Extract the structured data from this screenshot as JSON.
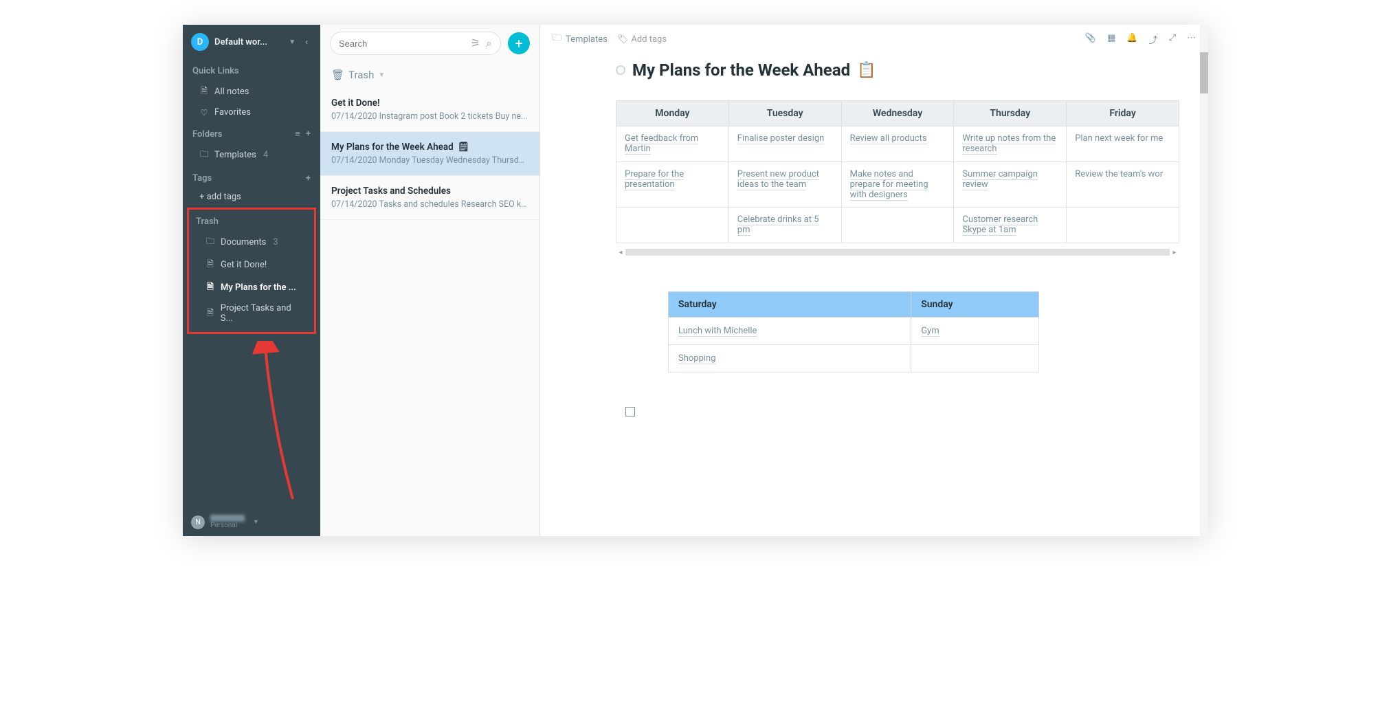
{
  "workspace": {
    "avatar": "D",
    "name": "Default wor..."
  },
  "sidebar": {
    "quick_links_label": "Quick Links",
    "all_notes": "All notes",
    "favorites": "Favorites",
    "folders_label": "Folders",
    "templates": {
      "label": "Templates",
      "count": "4"
    },
    "tags_label": "Tags",
    "add_tags": "+ add tags",
    "trash_label": "Trash",
    "trash_items": {
      "documents": {
        "label": "Documents",
        "count": "3"
      },
      "get_it_done": "Get it Done!",
      "my_plans": "My Plans for the ...",
      "project_tasks": "Project Tasks and S..."
    }
  },
  "user": {
    "avatar": "N",
    "plan": "Personal"
  },
  "search": {
    "placeholder": "Search"
  },
  "list": {
    "title": "Trash",
    "items": [
      {
        "title": "Get it Done!",
        "preview": "07/14/2020 Instagram post Book 2 tickets Buy ne..."
      },
      {
        "title": "My Plans for the Week Ahead",
        "preview": "07/14/2020 Monday Tuesday Wednesday Thursda..."
      },
      {
        "title": "Project Tasks and Schedules",
        "preview": "07/14/2020 Tasks and schedules Research SEO ke..."
      }
    ]
  },
  "doc": {
    "breadcrumb": "Templates",
    "add_tags": "Add tags",
    "title": "My Plans for the Week Ahead",
    "emoji": "📋",
    "week": {
      "headers": [
        "Monday",
        "Tuesday",
        "Wednesday",
        "Thursday",
        "Friday"
      ],
      "rows": [
        [
          "Get feedback from Martin",
          "Finalise poster design",
          "Review all products",
          "Write up notes from the research",
          "Plan next week for me"
        ],
        [
          "Prepare for the presentation",
          "Present new product ideas to the team",
          "Make notes and prepare for meeting with designers",
          "Summer campaign review",
          "Review the team's wor"
        ],
        [
          "",
          "Celebrate drinks at 5 pm",
          "",
          "Customer research Skype at 1am",
          ""
        ]
      ]
    },
    "weekend": {
      "headers": [
        "Saturday",
        "Sunday"
      ],
      "rows": [
        [
          "Lunch with Michelle",
          "Gym"
        ],
        [
          "Shopping",
          ""
        ]
      ]
    }
  }
}
